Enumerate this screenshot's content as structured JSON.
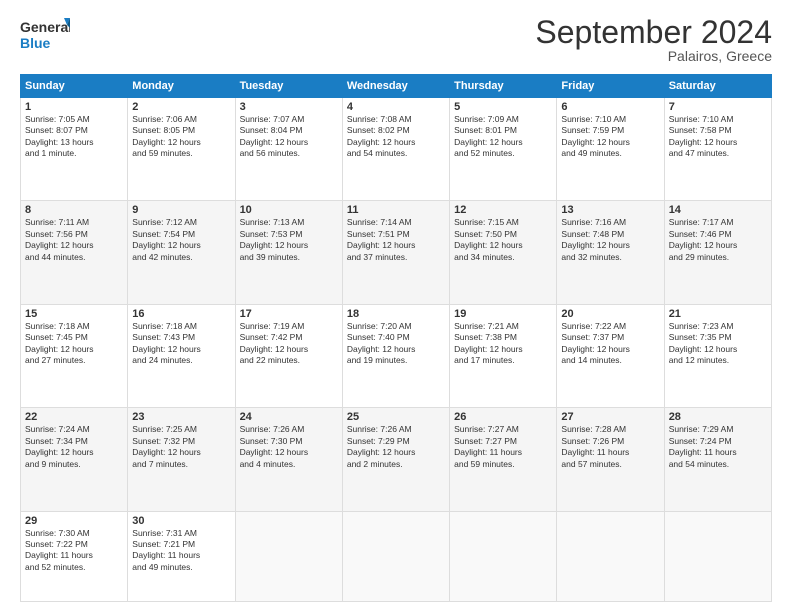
{
  "header": {
    "logo_line1": "General",
    "logo_line2": "Blue",
    "month": "September 2024",
    "location": "Palairos, Greece"
  },
  "weekdays": [
    "Sunday",
    "Monday",
    "Tuesday",
    "Wednesday",
    "Thursday",
    "Friday",
    "Saturday"
  ],
  "weeks": [
    [
      {
        "day": "1",
        "lines": [
          "Sunrise: 7:05 AM",
          "Sunset: 8:07 PM",
          "Daylight: 13 hours",
          "and 1 minute."
        ]
      },
      {
        "day": "2",
        "lines": [
          "Sunrise: 7:06 AM",
          "Sunset: 8:05 PM",
          "Daylight: 12 hours",
          "and 59 minutes."
        ]
      },
      {
        "day": "3",
        "lines": [
          "Sunrise: 7:07 AM",
          "Sunset: 8:04 PM",
          "Daylight: 12 hours",
          "and 56 minutes."
        ]
      },
      {
        "day": "4",
        "lines": [
          "Sunrise: 7:08 AM",
          "Sunset: 8:02 PM",
          "Daylight: 12 hours",
          "and 54 minutes."
        ]
      },
      {
        "day": "5",
        "lines": [
          "Sunrise: 7:09 AM",
          "Sunset: 8:01 PM",
          "Daylight: 12 hours",
          "and 52 minutes."
        ]
      },
      {
        "day": "6",
        "lines": [
          "Sunrise: 7:10 AM",
          "Sunset: 7:59 PM",
          "Daylight: 12 hours",
          "and 49 minutes."
        ]
      },
      {
        "day": "7",
        "lines": [
          "Sunrise: 7:10 AM",
          "Sunset: 7:58 PM",
          "Daylight: 12 hours",
          "and 47 minutes."
        ]
      }
    ],
    [
      {
        "day": "8",
        "lines": [
          "Sunrise: 7:11 AM",
          "Sunset: 7:56 PM",
          "Daylight: 12 hours",
          "and 44 minutes."
        ]
      },
      {
        "day": "9",
        "lines": [
          "Sunrise: 7:12 AM",
          "Sunset: 7:54 PM",
          "Daylight: 12 hours",
          "and 42 minutes."
        ]
      },
      {
        "day": "10",
        "lines": [
          "Sunrise: 7:13 AM",
          "Sunset: 7:53 PM",
          "Daylight: 12 hours",
          "and 39 minutes."
        ]
      },
      {
        "day": "11",
        "lines": [
          "Sunrise: 7:14 AM",
          "Sunset: 7:51 PM",
          "Daylight: 12 hours",
          "and 37 minutes."
        ]
      },
      {
        "day": "12",
        "lines": [
          "Sunrise: 7:15 AM",
          "Sunset: 7:50 PM",
          "Daylight: 12 hours",
          "and 34 minutes."
        ]
      },
      {
        "day": "13",
        "lines": [
          "Sunrise: 7:16 AM",
          "Sunset: 7:48 PM",
          "Daylight: 12 hours",
          "and 32 minutes."
        ]
      },
      {
        "day": "14",
        "lines": [
          "Sunrise: 7:17 AM",
          "Sunset: 7:46 PM",
          "Daylight: 12 hours",
          "and 29 minutes."
        ]
      }
    ],
    [
      {
        "day": "15",
        "lines": [
          "Sunrise: 7:18 AM",
          "Sunset: 7:45 PM",
          "Daylight: 12 hours",
          "and 27 minutes."
        ]
      },
      {
        "day": "16",
        "lines": [
          "Sunrise: 7:18 AM",
          "Sunset: 7:43 PM",
          "Daylight: 12 hours",
          "and 24 minutes."
        ]
      },
      {
        "day": "17",
        "lines": [
          "Sunrise: 7:19 AM",
          "Sunset: 7:42 PM",
          "Daylight: 12 hours",
          "and 22 minutes."
        ]
      },
      {
        "day": "18",
        "lines": [
          "Sunrise: 7:20 AM",
          "Sunset: 7:40 PM",
          "Daylight: 12 hours",
          "and 19 minutes."
        ]
      },
      {
        "day": "19",
        "lines": [
          "Sunrise: 7:21 AM",
          "Sunset: 7:38 PM",
          "Daylight: 12 hours",
          "and 17 minutes."
        ]
      },
      {
        "day": "20",
        "lines": [
          "Sunrise: 7:22 AM",
          "Sunset: 7:37 PM",
          "Daylight: 12 hours",
          "and 14 minutes."
        ]
      },
      {
        "day": "21",
        "lines": [
          "Sunrise: 7:23 AM",
          "Sunset: 7:35 PM",
          "Daylight: 12 hours",
          "and 12 minutes."
        ]
      }
    ],
    [
      {
        "day": "22",
        "lines": [
          "Sunrise: 7:24 AM",
          "Sunset: 7:34 PM",
          "Daylight: 12 hours",
          "and 9 minutes."
        ]
      },
      {
        "day": "23",
        "lines": [
          "Sunrise: 7:25 AM",
          "Sunset: 7:32 PM",
          "Daylight: 12 hours",
          "and 7 minutes."
        ]
      },
      {
        "day": "24",
        "lines": [
          "Sunrise: 7:26 AM",
          "Sunset: 7:30 PM",
          "Daylight: 12 hours",
          "and 4 minutes."
        ]
      },
      {
        "day": "25",
        "lines": [
          "Sunrise: 7:26 AM",
          "Sunset: 7:29 PM",
          "Daylight: 12 hours",
          "and 2 minutes."
        ]
      },
      {
        "day": "26",
        "lines": [
          "Sunrise: 7:27 AM",
          "Sunset: 7:27 PM",
          "Daylight: 11 hours",
          "and 59 minutes."
        ]
      },
      {
        "day": "27",
        "lines": [
          "Sunrise: 7:28 AM",
          "Sunset: 7:26 PM",
          "Daylight: 11 hours",
          "and 57 minutes."
        ]
      },
      {
        "day": "28",
        "lines": [
          "Sunrise: 7:29 AM",
          "Sunset: 7:24 PM",
          "Daylight: 11 hours",
          "and 54 minutes."
        ]
      }
    ],
    [
      {
        "day": "29",
        "lines": [
          "Sunrise: 7:30 AM",
          "Sunset: 7:22 PM",
          "Daylight: 11 hours",
          "and 52 minutes."
        ]
      },
      {
        "day": "30",
        "lines": [
          "Sunrise: 7:31 AM",
          "Sunset: 7:21 PM",
          "Daylight: 11 hours",
          "and 49 minutes."
        ]
      },
      {
        "day": "",
        "lines": []
      },
      {
        "day": "",
        "lines": []
      },
      {
        "day": "",
        "lines": []
      },
      {
        "day": "",
        "lines": []
      },
      {
        "day": "",
        "lines": []
      }
    ]
  ]
}
